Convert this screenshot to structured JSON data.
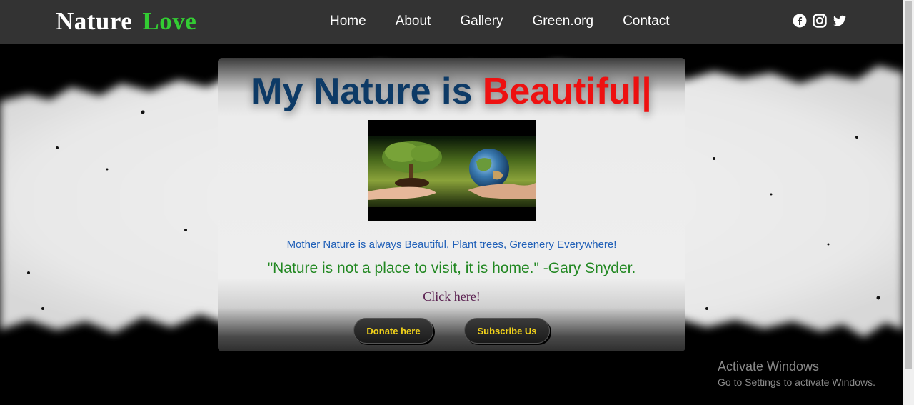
{
  "brand": {
    "word1": "Nature",
    "word2": "Love"
  },
  "nav": {
    "items": [
      "Home",
      "About",
      "Gallery",
      "Green.org",
      "Contact"
    ]
  },
  "social": {
    "icons": [
      "facebook-icon",
      "instagram-icon",
      "twitter-icon"
    ]
  },
  "hero": {
    "headline_part1": "My Nature is ",
    "headline_part2": "Beautiful",
    "cursor": "|",
    "tagline": "Mother Nature is always Beautiful, Plant trees, Greenery Everywhere!",
    "quote": "\"Nature is not a place to visit, it is home.\" -Gary Snyder.",
    "click_text": "Click here!",
    "donate_label": "Donate here",
    "subscribe_label": "Subscribe Us"
  },
  "watermark": {
    "title": "Activate Windows",
    "subtitle": "Go to Settings to activate Windows."
  },
  "colors": {
    "navbar": "#333333",
    "brand_accent": "#33cc33",
    "headline_blue": "#0d3a66",
    "headline_red": "#ee1111",
    "button_text": "#f2d21a"
  }
}
